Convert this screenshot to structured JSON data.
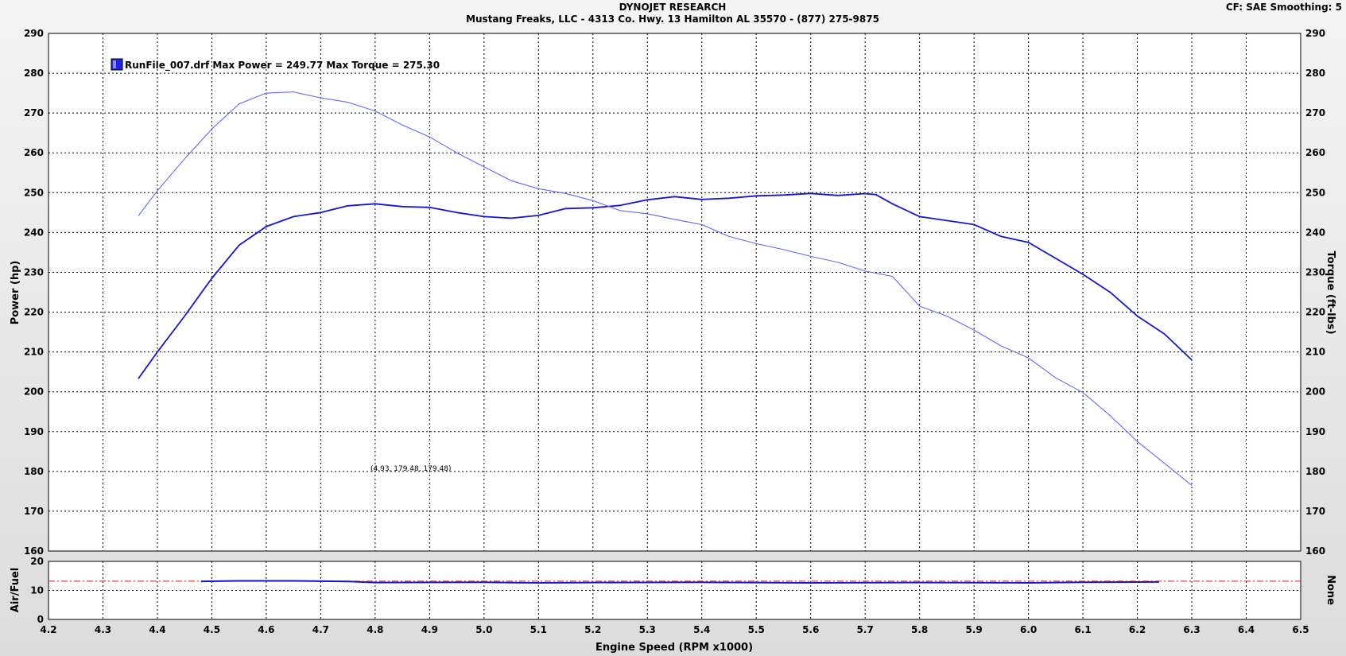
{
  "header": {
    "title": "DYNOJET RESEARCH",
    "subtitle": "Mustang Freaks, LLC - 4313 Co. Hwy. 13 Hamilton AL 35570 - (877) 275-9875",
    "settings": "CF: SAE  Smoothing: 5"
  },
  "chart_data": [
    {
      "type": "line",
      "xlabel": "Engine Speed (RPM x1000)",
      "ylabel": "Power (hp)",
      "y2label": "Torque (ft-lbs)",
      "xlim": [
        4.2,
        6.5
      ],
      "ylim": [
        160,
        290
      ],
      "y2lim": [
        160,
        290
      ],
      "x_ticks": [
        "4.2",
        "4.3",
        "4.4",
        "4.5",
        "4.6",
        "4.7",
        "4.8",
        "4.9",
        "5.0",
        "5.1",
        "5.2",
        "5.3",
        "5.4",
        "5.5",
        "5.6",
        "5.7",
        "5.8",
        "5.9",
        "6.0",
        "6.1",
        "6.2",
        "6.3",
        "6.4",
        "6.5"
      ],
      "y_ticks": [
        "160",
        "170",
        "180",
        "190",
        "200",
        "210",
        "220",
        "230",
        "240",
        "250",
        "260",
        "270",
        "280",
        "290"
      ],
      "grid": true,
      "legend": {
        "position": "top-left",
        "text": "RunFile_007.drf Max Power = 249.77 Max Torque = 275.30",
        "color": "#2222ee"
      },
      "annotation": "(4.93, 179.48, 179.48)",
      "series": [
        {
          "role": "power",
          "color": "#1515d6",
          "x": [
            4.365,
            4.4,
            4.45,
            4.5,
            4.55,
            4.6,
            4.65,
            4.7,
            4.75,
            4.8,
            4.85,
            4.9,
            4.95,
            5.0,
            5.05,
            5.1,
            5.15,
            5.2,
            5.25,
            5.3,
            5.35,
            5.4,
            5.45,
            5.5,
            5.55,
            5.6,
            5.65,
            5.7,
            5.72,
            5.75,
            5.8,
            5.85,
            5.9,
            5.95,
            6.0,
            6.05,
            6.1,
            6.15,
            6.2,
            6.25,
            6.3
          ],
          "values": [
            203.3,
            210.0,
            219.0,
            228.5,
            236.8,
            241.5,
            244.0,
            245.0,
            246.7,
            247.2,
            246.5,
            246.3,
            245.0,
            244.0,
            243.6,
            244.3,
            246.0,
            246.2,
            246.8,
            248.2,
            249.0,
            248.3,
            248.6,
            249.2,
            249.4,
            249.8,
            249.3,
            249.77,
            249.5,
            247.2,
            244.0,
            243.0,
            242.0,
            239.0,
            237.5,
            233.5,
            229.5,
            225.0,
            219.0,
            214.5,
            208.0
          ]
        },
        {
          "role": "torque",
          "color": "#6666ff",
          "x": [
            4.365,
            4.4,
            4.45,
            4.5,
            4.55,
            4.6,
            4.65,
            4.7,
            4.75,
            4.8,
            4.85,
            4.9,
            4.95,
            5.0,
            5.05,
            5.1,
            5.15,
            5.2,
            5.25,
            5.3,
            5.35,
            5.4,
            5.45,
            5.5,
            5.55,
            5.6,
            5.65,
            5.7,
            5.75,
            5.8,
            5.85,
            5.9,
            5.95,
            6.0,
            6.05,
            6.1,
            6.15,
            6.2,
            6.25,
            6.3
          ],
          "values": [
            244.2,
            250.5,
            258.5,
            266.0,
            272.3,
            275.0,
            275.3,
            273.8,
            272.7,
            270.5,
            267.0,
            264.0,
            260.0,
            256.5,
            253.0,
            251.0,
            249.8,
            248.0,
            245.5,
            244.7,
            243.3,
            242.0,
            239.0,
            237.2,
            235.7,
            234.0,
            232.5,
            230.3,
            229.0,
            221.5,
            219.0,
            215.5,
            211.5,
            208.5,
            203.5,
            199.8,
            194.0,
            187.5,
            182.0,
            176.5
          ]
        }
      ]
    },
    {
      "type": "line",
      "ylabel": "Air/Fuel",
      "y2label": "None",
      "xlim": [
        4.2,
        6.5
      ],
      "ylim": [
        0,
        20
      ],
      "y_ticks": [
        "0",
        "10",
        "20"
      ],
      "grid": true,
      "reference_line": {
        "value": 13.2,
        "color": "#dd2222",
        "style": "dash-dot"
      },
      "series": [
        {
          "role": "afr",
          "color": "#1515d6",
          "x": [
            4.48,
            4.55,
            4.65,
            4.75,
            4.8,
            5.0,
            5.1,
            5.2,
            5.4,
            5.6,
            5.8,
            6.0,
            6.1,
            6.24
          ],
          "values": [
            13.1,
            13.3,
            13.3,
            13.1,
            12.7,
            12.8,
            12.6,
            12.7,
            12.8,
            12.6,
            12.7,
            12.6,
            12.8,
            12.9
          ]
        }
      ]
    }
  ]
}
